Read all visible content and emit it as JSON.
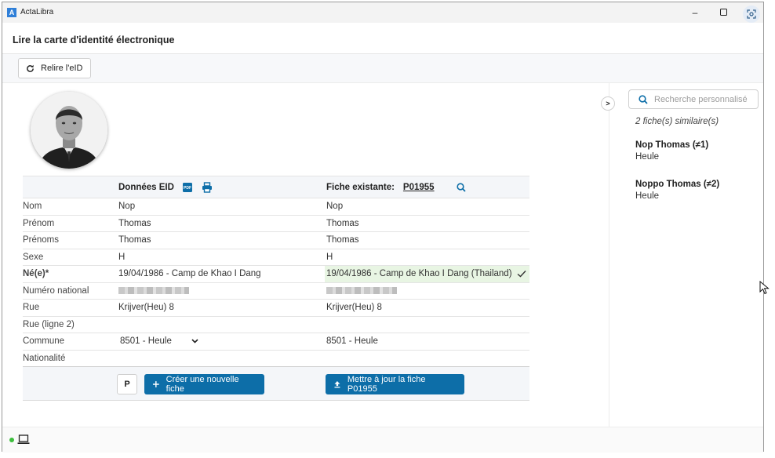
{
  "window": {
    "title": "ActaLibra",
    "logo_letter": "A"
  },
  "page": {
    "title": "Lire la carte d'identité électronique"
  },
  "toolbar": {
    "reload_label": "Relire l'eID"
  },
  "compare": {
    "header": {
      "eid_label": "Données EID",
      "existing_label": "Fiche existante:",
      "existing_id": "P01955"
    },
    "rows": {
      "nom": {
        "label": "Nom",
        "eid": "Nop",
        "existing": "Nop"
      },
      "prenom": {
        "label": "Prénom",
        "eid": "Thomas",
        "existing": "Thomas"
      },
      "prenoms": {
        "label": "Prénoms",
        "eid": "Thomas",
        "existing": "Thomas"
      },
      "sexe": {
        "label": "Sexe",
        "eid": "H",
        "existing": "H"
      },
      "ne": {
        "label": "Né(e)*",
        "eid": "19/04/1986 - Camp de Khao I Dang",
        "existing": "19/04/1986 - Camp de Khao I Dang (Thailand)"
      },
      "numero": {
        "label": "Numéro national"
      },
      "rue": {
        "label": "Rue",
        "eid": "Krijver(Heu) 8",
        "existing": "Krijver(Heu) 8"
      },
      "rue2": {
        "label": "Rue (ligne 2)"
      },
      "commune": {
        "label": "Commune",
        "eid": "8501 - Heule",
        "existing": "8501 - Heule"
      },
      "nationalite": {
        "label": "Nationalité"
      }
    }
  },
  "actions": {
    "p_label": "P",
    "create_label": "Créer une nouvelle fiche",
    "update_label": "Mettre à jour la fiche P01955"
  },
  "sidebar": {
    "toggle_label": ">",
    "search_placeholder": "Recherche personnalisé",
    "similar_count": "2 fiche(s) similaire(s)",
    "matches": [
      {
        "name": "Nop Thomas (≠1)",
        "city": "Heule"
      },
      {
        "name": "Noppo Thomas (≠2)",
        "city": "Heule"
      }
    ]
  },
  "colors": {
    "primary": "#0d6ea8",
    "match_bg": "#e8f5e3",
    "status_online": "#3cbf3c"
  },
  "icons": [
    "refresh-icon",
    "pdf-icon",
    "print-icon",
    "search-icon",
    "check-icon",
    "chevron-down-icon",
    "plus-icon",
    "upload-icon",
    "laptop-icon",
    "minimize-icon",
    "maximize-icon",
    "screen-capture-icon",
    "cursor-icon"
  ]
}
